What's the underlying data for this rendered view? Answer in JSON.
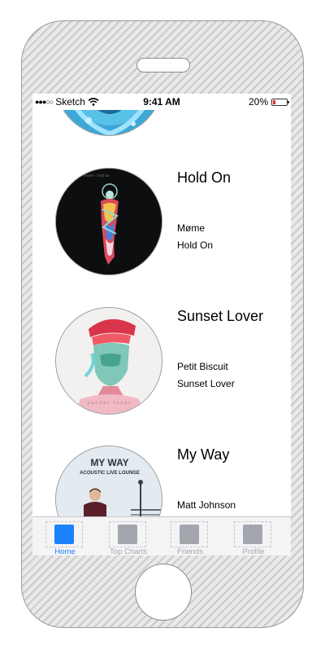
{
  "status_bar": {
    "signal": "●●●○○",
    "carrier": "Sketch",
    "time": "9:41 AM",
    "battery_percent": "20%",
    "battery_level": 0.2
  },
  "songs": [
    {
      "title": "Hold On",
      "artist": "Møme",
      "song": "Hold On"
    },
    {
      "title": "Sunset Lover",
      "artist": "Petit Biscuit",
      "song": "Sunset Lover"
    },
    {
      "title": "My Way",
      "artist": "Matt Johnson",
      "song": "",
      "art_text_1": "MY WAY",
      "art_text_2": "ACOUSTIC LIVE LOUNGE"
    }
  ],
  "album_art_text": {
    "sunset_lover": "sunset lover"
  },
  "tabs": [
    {
      "label": "Home",
      "active": true,
      "color": "#1a82fb"
    },
    {
      "label": "Top Charts",
      "active": false,
      "color": "#a3a6ad"
    },
    {
      "label": "Friends",
      "active": false,
      "color": "#a3a6ad"
    },
    {
      "label": "Profile",
      "active": false,
      "color": "#a3a6ad"
    }
  ],
  "colors": {
    "accent": "#1a82fb",
    "inactive": "#a3a6ad"
  }
}
